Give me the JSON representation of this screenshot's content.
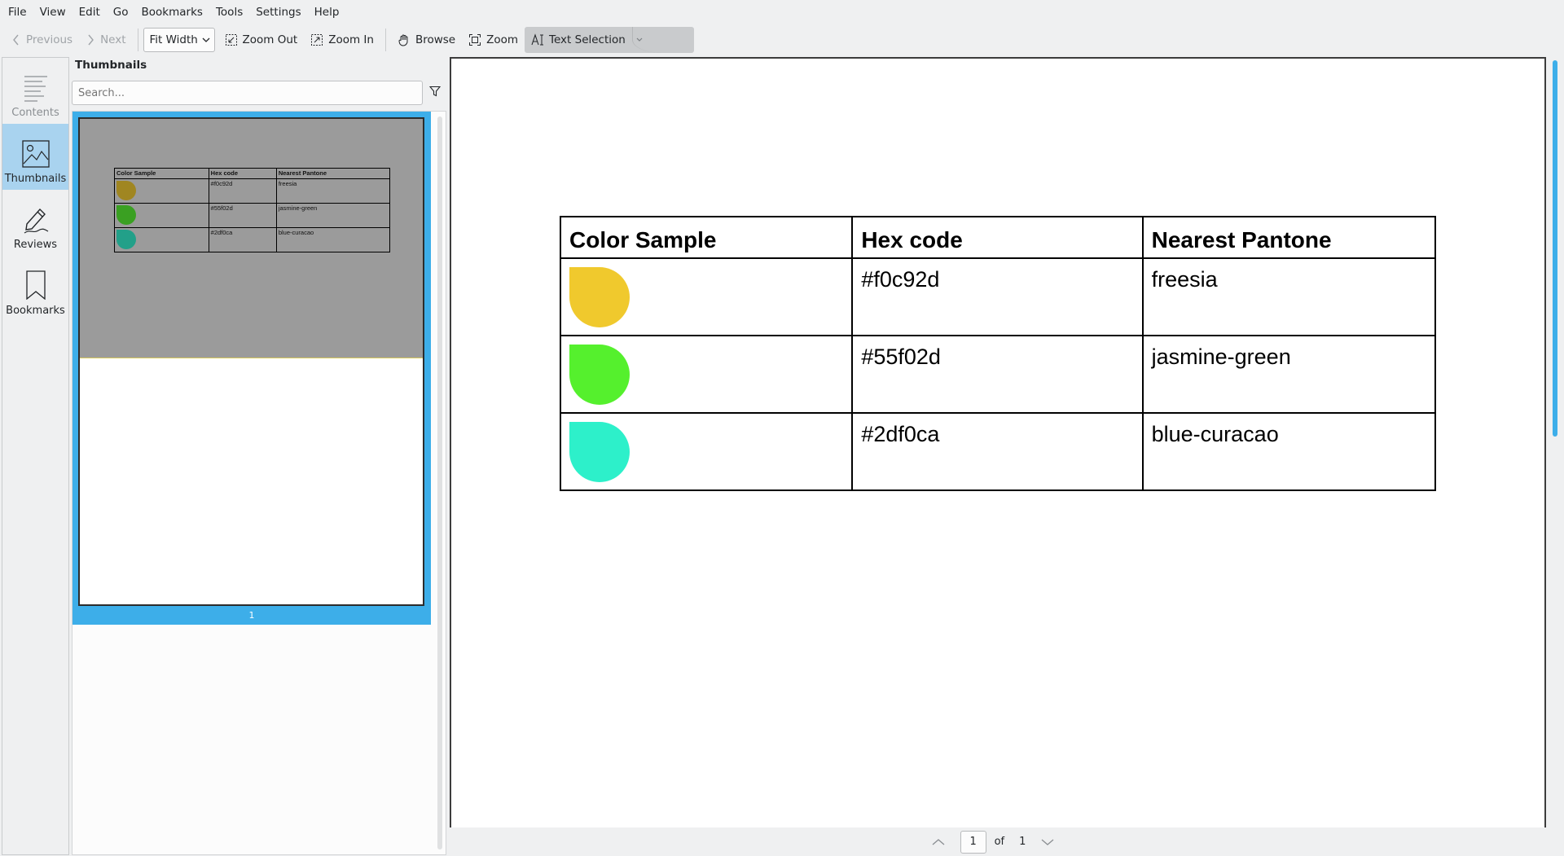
{
  "menubar": [
    "File",
    "View",
    "Edit",
    "Go",
    "Bookmarks",
    "Tools",
    "Settings",
    "Help"
  ],
  "toolbar": {
    "previous": "Previous",
    "next": "Next",
    "zoom_mode": "Fit Width",
    "zoom_out": "Zoom Out",
    "zoom_in": "Zoom In",
    "browse": "Browse",
    "zoom": "Zoom",
    "text_selection": "Text Selection"
  },
  "sidebar": {
    "contents": "Contents",
    "thumbnails": "Thumbnails",
    "reviews": "Reviews",
    "bookmarks": "Bookmarks"
  },
  "thumbnails_panel": {
    "title": "Thumbnails",
    "search_placeholder": "Search...",
    "page_number": "1"
  },
  "document": {
    "headers": [
      "Color Sample",
      "Hex code",
      "Nearest Pantone"
    ],
    "rows": [
      {
        "hex": "#f0c92d",
        "pantone": "freesia",
        "color": "#f0c92d",
        "thumb_color": "#a08621"
      },
      {
        "hex": "#55f02d",
        "pantone": "jasmine-green",
        "color": "#55f02d",
        "thumb_color": "#3aa022"
      },
      {
        "hex": "#2df0ca",
        "pantone": "blue-curacao",
        "color": "#2df0ca",
        "thumb_color": "#22a089"
      }
    ]
  },
  "pagination": {
    "current": "1",
    "of": "of",
    "total": "1"
  }
}
